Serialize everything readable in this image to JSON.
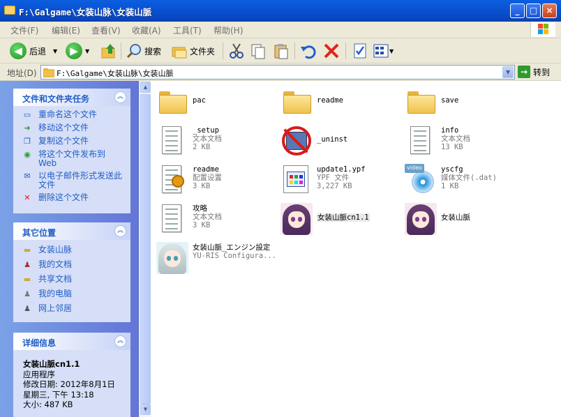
{
  "window": {
    "title": "F:\\Galgame\\女装山脉\\女装山脈"
  },
  "menu": [
    "文件(F)",
    "编辑(E)",
    "查看(V)",
    "收藏(A)",
    "工具(T)",
    "帮助(H)"
  ],
  "toolbar": {
    "back": "后退",
    "search": "搜索",
    "folders": "文件夹"
  },
  "address": {
    "label": "地址(D)",
    "value": "F:\\Galgame\\女装山脉\\女装山脈",
    "go": "转到"
  },
  "tasks": {
    "title": "文件和文件夹任务",
    "items": [
      "重命名这个文件",
      "移动这个文件",
      "复制这个文件",
      "将这个文件发布到 Web",
      "以电子邮件形式发送此文件",
      "删除这个文件"
    ]
  },
  "places": {
    "title": "其它位置",
    "items": [
      "女装山脉",
      "我的文档",
      "共享文档",
      "我的电脑",
      "网上邻居"
    ]
  },
  "details": {
    "title": "详细信息",
    "name": "女装山脈cn1.1",
    "type": "应用程序",
    "modified_label": "修改日期: 2012年8月1日",
    "modified_time": "星期三, 下午 13:18",
    "size": "大小: 487 KB"
  },
  "files": [
    {
      "name": "pac",
      "line2": "",
      "line3": "",
      "icon": "folder-icon"
    },
    {
      "name": "readme",
      "line2": "",
      "line3": "",
      "icon": "folder-icon"
    },
    {
      "name": "save",
      "line2": "",
      "line3": "",
      "icon": "folder-icon"
    },
    {
      "name": "_setup",
      "line2": "文本文档",
      "line3": "2 KB",
      "icon": "text-document-icon"
    },
    {
      "name": "_uninst",
      "line2": "",
      "line3": "",
      "icon": "uninstall-icon"
    },
    {
      "name": "info",
      "line2": "文本文档",
      "line3": "13 KB",
      "icon": "text-document-icon"
    },
    {
      "name": "readme",
      "line2": "配置设置",
      "line3": "3 KB",
      "icon": "config-settings-icon"
    },
    {
      "name": "update1.ypf",
      "line2": "YPF 文件",
      "line3": "3,227 KB",
      "icon": "ypf-file-icon"
    },
    {
      "name": "yscfg",
      "line2": "媒体文件(.dat)",
      "line3": "1 KB",
      "icon": "media-file-icon"
    },
    {
      "name": "攻略",
      "line2": "文本文档",
      "line3": "3 KB",
      "icon": "text-document-icon"
    },
    {
      "name": "女装山脈cn1.1",
      "line2": "",
      "line3": "",
      "icon": "anime-app-icon"
    },
    {
      "name": "女装山脈",
      "line2": "",
      "line3": "",
      "icon": "anime-app-icon"
    },
    {
      "name": "女装山脈_エンジン設定",
      "line2": "YU-RIS Configura...",
      "line3": "",
      "icon": "anime-config-icon"
    }
  ]
}
